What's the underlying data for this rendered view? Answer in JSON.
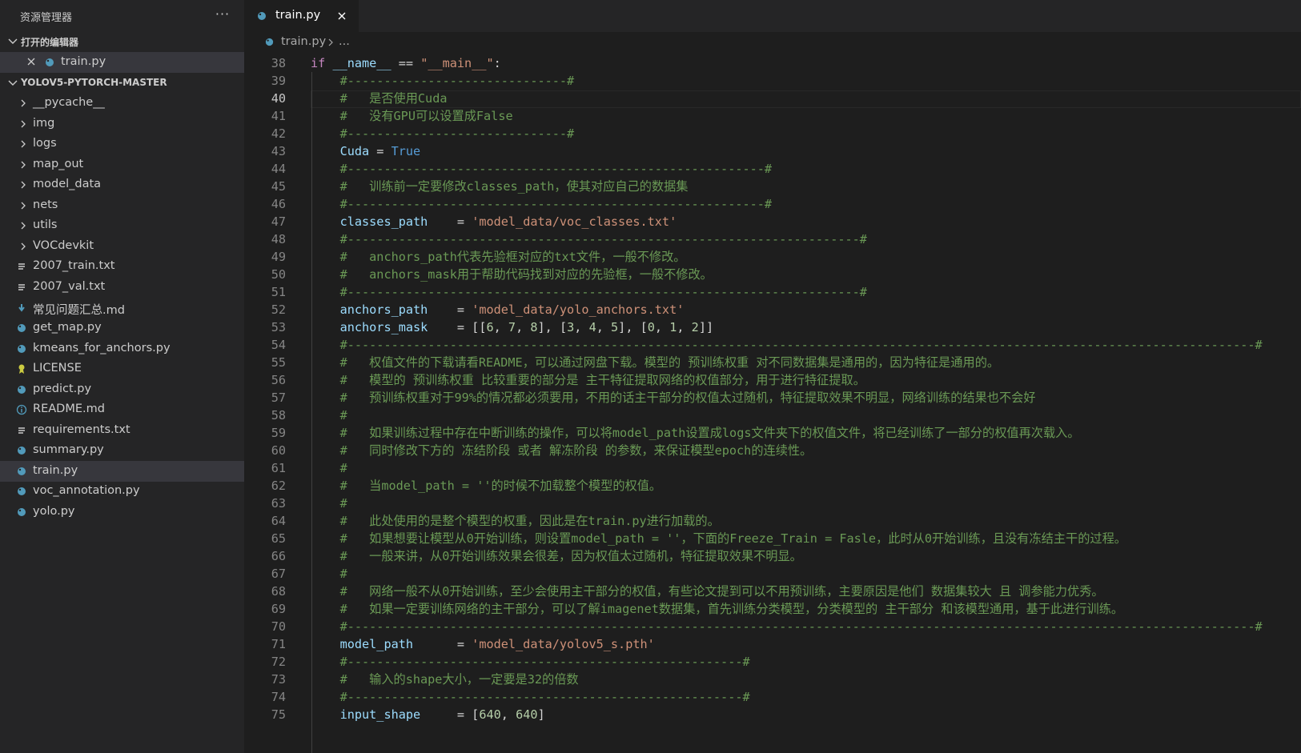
{
  "sidebar": {
    "title": "资源管理器",
    "more": "···",
    "open_editors": {
      "label": "打开的编辑器",
      "items": [
        {
          "name": "train.py",
          "icon": "python-icon"
        }
      ]
    },
    "project": {
      "label": "YOLOV5-PYTORCH-MASTER",
      "items": [
        {
          "name": "__pycache__",
          "kind": "folder"
        },
        {
          "name": "img",
          "kind": "folder"
        },
        {
          "name": "logs",
          "kind": "folder"
        },
        {
          "name": "map_out",
          "kind": "folder"
        },
        {
          "name": "model_data",
          "kind": "folder"
        },
        {
          "name": "nets",
          "kind": "folder"
        },
        {
          "name": "utils",
          "kind": "folder"
        },
        {
          "name": "VOCdevkit",
          "kind": "folder"
        },
        {
          "name": "2007_train.txt",
          "kind": "text"
        },
        {
          "name": "2007_val.txt",
          "kind": "text"
        },
        {
          "name": "常见问题汇总.md",
          "kind": "markdown"
        },
        {
          "name": "get_map.py",
          "kind": "python"
        },
        {
          "name": "kmeans_for_anchors.py",
          "kind": "python"
        },
        {
          "name": "LICENSE",
          "kind": "license"
        },
        {
          "name": "predict.py",
          "kind": "python"
        },
        {
          "name": "README.md",
          "kind": "info"
        },
        {
          "name": "requirements.txt",
          "kind": "text"
        },
        {
          "name": "summary.py",
          "kind": "python"
        },
        {
          "name": "train.py",
          "kind": "python",
          "selected": true
        },
        {
          "name": "voc_annotation.py",
          "kind": "python"
        },
        {
          "name": "yolo.py",
          "kind": "python"
        }
      ]
    }
  },
  "tab": {
    "name": "train.py"
  },
  "breadcrumb": {
    "file": "train.py",
    "more": "..."
  },
  "editor": {
    "active_line": 40,
    "lines": [
      {
        "n": 38,
        "t": [
          [
            "kw",
            "if"
          ],
          [
            "op",
            " "
          ],
          [
            "var",
            "__name__"
          ],
          [
            "op",
            " == "
          ],
          [
            "str",
            "\"__main__\""
          ],
          [
            "op",
            ":"
          ]
        ]
      },
      {
        "n": 39,
        "t": [
          [
            "op",
            "    "
          ],
          [
            "cm",
            "#------------------------------#"
          ]
        ]
      },
      {
        "n": 40,
        "t": [
          [
            "op",
            "    "
          ],
          [
            "cm",
            "#   是否使用Cuda"
          ]
        ]
      },
      {
        "n": 41,
        "t": [
          [
            "op",
            "    "
          ],
          [
            "cm",
            "#   没有GPU可以设置成False"
          ]
        ]
      },
      {
        "n": 42,
        "t": [
          [
            "op",
            "    "
          ],
          [
            "cm",
            "#------------------------------#"
          ]
        ]
      },
      {
        "n": 43,
        "t": [
          [
            "op",
            "    "
          ],
          [
            "var",
            "Cuda"
          ],
          [
            "op",
            " = "
          ],
          [
            "cst",
            "True"
          ]
        ]
      },
      {
        "n": 44,
        "t": [
          [
            "op",
            "    "
          ],
          [
            "cm",
            "#---------------------------------------------------------#"
          ]
        ]
      },
      {
        "n": 45,
        "t": [
          [
            "op",
            "    "
          ],
          [
            "cm",
            "#   训练前一定要修改classes_path，使其对应自己的数据集"
          ]
        ]
      },
      {
        "n": 46,
        "t": [
          [
            "op",
            "    "
          ],
          [
            "cm",
            "#---------------------------------------------------------#"
          ]
        ]
      },
      {
        "n": 47,
        "t": [
          [
            "op",
            "    "
          ],
          [
            "var",
            "classes_path"
          ],
          [
            "op",
            "    = "
          ],
          [
            "str",
            "'model_data/voc_classes.txt'"
          ]
        ]
      },
      {
        "n": 48,
        "t": [
          [
            "op",
            "    "
          ],
          [
            "cm",
            "#----------------------------------------------------------------------#"
          ]
        ]
      },
      {
        "n": 49,
        "t": [
          [
            "op",
            "    "
          ],
          [
            "cm",
            "#   anchors_path代表先验框对应的txt文件，一般不修改。"
          ]
        ]
      },
      {
        "n": 50,
        "t": [
          [
            "op",
            "    "
          ],
          [
            "cm",
            "#   anchors_mask用于帮助代码找到对应的先验框，一般不修改。"
          ]
        ]
      },
      {
        "n": 51,
        "t": [
          [
            "op",
            "    "
          ],
          [
            "cm",
            "#----------------------------------------------------------------------#"
          ]
        ]
      },
      {
        "n": 52,
        "t": [
          [
            "op",
            "    "
          ],
          [
            "var",
            "anchors_path"
          ],
          [
            "op",
            "    = "
          ],
          [
            "str",
            "'model_data/yolo_anchors.txt'"
          ]
        ]
      },
      {
        "n": 53,
        "t": [
          [
            "op",
            "    "
          ],
          [
            "var",
            "anchors_mask"
          ],
          [
            "op",
            "    = [["
          ],
          [
            "num",
            "6"
          ],
          [
            "op",
            ", "
          ],
          [
            "num",
            "7"
          ],
          [
            "op",
            ", "
          ],
          [
            "num",
            "8"
          ],
          [
            "op",
            "], ["
          ],
          [
            "num",
            "3"
          ],
          [
            "op",
            ", "
          ],
          [
            "num",
            "4"
          ],
          [
            "op",
            ", "
          ],
          [
            "num",
            "5"
          ],
          [
            "op",
            "], ["
          ],
          [
            "num",
            "0"
          ],
          [
            "op",
            ", "
          ],
          [
            "num",
            "1"
          ],
          [
            "op",
            ", "
          ],
          [
            "num",
            "2"
          ],
          [
            "op",
            "]]"
          ]
        ]
      },
      {
        "n": 54,
        "t": [
          [
            "op",
            "    "
          ],
          [
            "cm",
            "#----------------------------------------------------------------------------------------------------------------------------#"
          ]
        ]
      },
      {
        "n": 55,
        "t": [
          [
            "op",
            "    "
          ],
          [
            "cm",
            "#   权值文件的下载请看README，可以通过网盘下载。模型的 预训练权重 对不同数据集是通用的，因为特征是通用的。"
          ]
        ]
      },
      {
        "n": 56,
        "t": [
          [
            "op",
            "    "
          ],
          [
            "cm",
            "#   模型的 预训练权重 比较重要的部分是 主干特征提取网络的权值部分，用于进行特征提取。"
          ]
        ]
      },
      {
        "n": 57,
        "t": [
          [
            "op",
            "    "
          ],
          [
            "cm",
            "#   预训练权重对于99%的情况都必须要用，不用的话主干部分的权值太过随机，特征提取效果不明显，网络训练的结果也不会好"
          ]
        ]
      },
      {
        "n": 58,
        "t": [
          [
            "op",
            "    "
          ],
          [
            "cm",
            "#"
          ]
        ]
      },
      {
        "n": 59,
        "t": [
          [
            "op",
            "    "
          ],
          [
            "cm",
            "#   如果训练过程中存在中断训练的操作，可以将model_path设置成logs文件夹下的权值文件，将已经训练了一部分的权值再次载入。"
          ]
        ]
      },
      {
        "n": 60,
        "t": [
          [
            "op",
            "    "
          ],
          [
            "cm",
            "#   同时修改下方的 冻结阶段 或者 解冻阶段 的参数，来保证模型epoch的连续性。"
          ]
        ]
      },
      {
        "n": 61,
        "t": [
          [
            "op",
            "    "
          ],
          [
            "cm",
            "#"
          ]
        ]
      },
      {
        "n": 62,
        "t": [
          [
            "op",
            "    "
          ],
          [
            "cm",
            "#   当model_path = ''的时候不加载整个模型的权值。"
          ]
        ]
      },
      {
        "n": 63,
        "t": [
          [
            "op",
            "    "
          ],
          [
            "cm",
            "#"
          ]
        ]
      },
      {
        "n": 64,
        "t": [
          [
            "op",
            "    "
          ],
          [
            "cm",
            "#   此处使用的是整个模型的权重，因此是在train.py进行加载的。"
          ]
        ]
      },
      {
        "n": 65,
        "t": [
          [
            "op",
            "    "
          ],
          [
            "cm",
            "#   如果想要让模型从0开始训练，则设置model_path = ''，下面的Freeze_Train = Fasle，此时从0开始训练，且没有冻结主干的过程。"
          ]
        ]
      },
      {
        "n": 66,
        "t": [
          [
            "op",
            "    "
          ],
          [
            "cm",
            "#   一般来讲，从0开始训练效果会很差，因为权值太过随机，特征提取效果不明显。"
          ]
        ]
      },
      {
        "n": 67,
        "t": [
          [
            "op",
            "    "
          ],
          [
            "cm",
            "#"
          ]
        ]
      },
      {
        "n": 68,
        "t": [
          [
            "op",
            "    "
          ],
          [
            "cm",
            "#   网络一般不从0开始训练，至少会使用主干部分的权值，有些论文提到可以不用预训练，主要原因是他们 数据集较大 且 调参能力优秀。"
          ]
        ]
      },
      {
        "n": 69,
        "t": [
          [
            "op",
            "    "
          ],
          [
            "cm",
            "#   如果一定要训练网络的主干部分，可以了解imagenet数据集，首先训练分类模型，分类模型的 主干部分 和该模型通用，基于此进行训练。"
          ]
        ]
      },
      {
        "n": 70,
        "t": [
          [
            "op",
            "    "
          ],
          [
            "cm",
            "#----------------------------------------------------------------------------------------------------------------------------#"
          ]
        ]
      },
      {
        "n": 71,
        "t": [
          [
            "op",
            "    "
          ],
          [
            "var",
            "model_path"
          ],
          [
            "op",
            "      = "
          ],
          [
            "str",
            "'model_data/yolov5_s.pth'"
          ]
        ]
      },
      {
        "n": 72,
        "t": [
          [
            "op",
            "    "
          ],
          [
            "cm",
            "#------------------------------------------------------#"
          ]
        ]
      },
      {
        "n": 73,
        "t": [
          [
            "op",
            "    "
          ],
          [
            "cm",
            "#   输入的shape大小，一定要是32的倍数"
          ]
        ]
      },
      {
        "n": 74,
        "t": [
          [
            "op",
            "    "
          ],
          [
            "cm",
            "#------------------------------------------------------#"
          ]
        ]
      },
      {
        "n": 75,
        "t": [
          [
            "op",
            "    "
          ],
          [
            "var",
            "input_shape"
          ],
          [
            "op",
            "     = ["
          ],
          [
            "num",
            "640"
          ],
          [
            "op",
            ", "
          ],
          [
            "num",
            "640"
          ],
          [
            "op",
            "]"
          ]
        ]
      }
    ]
  },
  "colors": {
    "sidebar_bg": "#252526",
    "editor_bg": "#1e1e1e",
    "selected_row": "#37373d",
    "python_icon": "#519aba",
    "markdown_icon": "#519aba",
    "license_icon": "#cbcb41",
    "comment": "#6a9955",
    "keyword": "#c586c0",
    "string": "#ce9178",
    "variable": "#9cdcfe",
    "number": "#b5cea8",
    "constant": "#569cd6"
  }
}
